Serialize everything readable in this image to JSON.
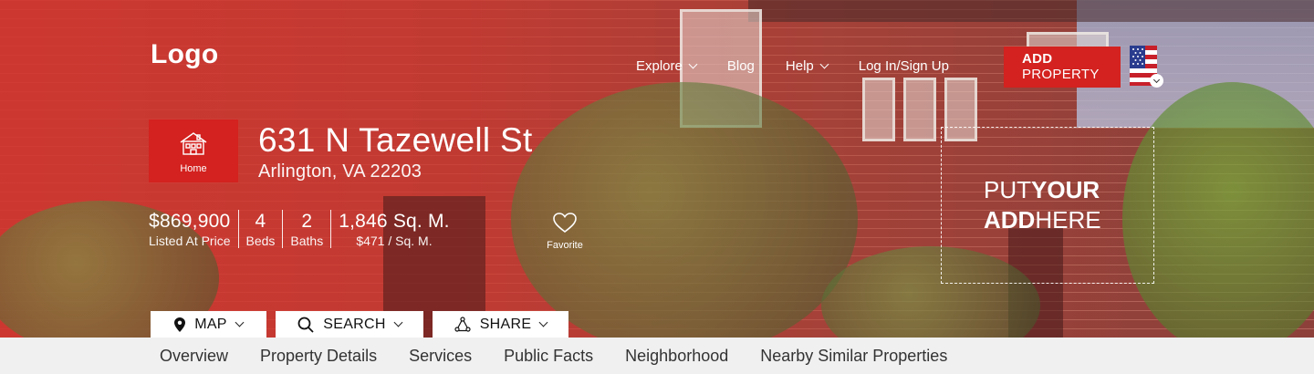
{
  "header": {
    "logo": "Logo",
    "nav": [
      {
        "label": "Explore",
        "has_dropdown": true
      },
      {
        "label": "Blog",
        "has_dropdown": false
      },
      {
        "label": "Help",
        "has_dropdown": true
      },
      {
        "label": "Log In/Sign Up",
        "has_dropdown": false
      }
    ],
    "add_property": {
      "line1": "ADD",
      "line2": "PROPERTY"
    },
    "language_flag_icon": "us-flag-icon"
  },
  "property": {
    "type_label": "Home",
    "type_icon": "house-icon",
    "address": "631 N Tazewell St",
    "city_state_zip": "Arlington, VA 22203",
    "stats": [
      {
        "value": "$869,900",
        "label": "Listed At Price"
      },
      {
        "value": "4",
        "label": "Beds"
      },
      {
        "value": "2",
        "label": "Baths"
      },
      {
        "value": "1,846 Sq. M.",
        "label": "$471 / Sq. M."
      }
    ],
    "favorite_label": "Favorite"
  },
  "ad": {
    "w1": "PUT",
    "w2": "YOUR",
    "w3": "ADD",
    "w4": "HERE"
  },
  "actions": [
    {
      "label": "MAP",
      "icon": "map-pin-icon"
    },
    {
      "label": "SEARCH",
      "icon": "search-icon"
    },
    {
      "label": "SHARE",
      "icon": "share-icon"
    }
  ],
  "tabs": [
    "Overview",
    "Property Details",
    "Services",
    "Public Facts",
    "Neighborhood",
    "Nearby Similar Properties"
  ],
  "colors": {
    "accent": "#d3221f",
    "overlay": "#c9372f",
    "tabbar_bg": "#f0f0f0"
  }
}
